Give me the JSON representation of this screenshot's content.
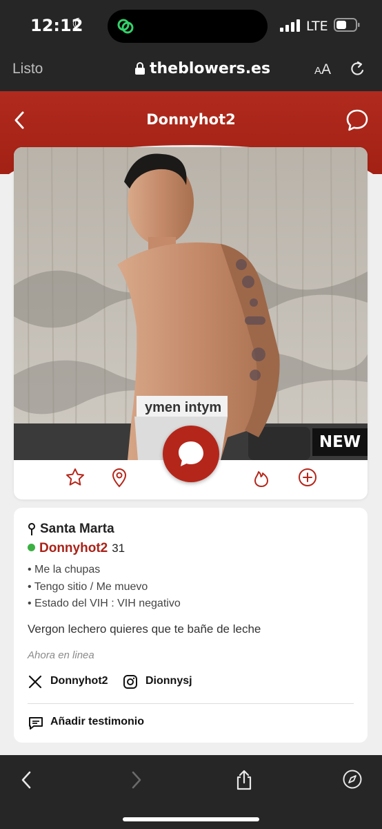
{
  "status": {
    "time": "12:12",
    "network": "LTE",
    "moon_icon": "moon-icon"
  },
  "browser": {
    "done_label": "Listo",
    "domain": "theblowers.es",
    "text_size_small": "A",
    "text_size_big": "A"
  },
  "header": {
    "title": "Donnyhot2"
  },
  "photo": {
    "badge": "NEW"
  },
  "actions": [
    "star-icon",
    "location-pin-icon",
    "chat-bubble-icon",
    "flame-icon",
    "plus-circle-icon"
  ],
  "profile": {
    "location": "Santa Marta",
    "username": "Donnyhot2",
    "age": "31",
    "bullets": [
      "• Me la chupas",
      "• Tengo sitio / Me muevo",
      "• Estado del VIH : VIH negativo"
    ],
    "description": "Vergon lechero quieres que te bañe de leche",
    "online_status": "Ahora en linea",
    "twitter": "Donnyhot2",
    "instagram": "Dionnysj",
    "add_testimonial": "Añadir testimonio"
  },
  "colors": {
    "brand_red": "#a92219",
    "online_green": "#3cb043",
    "dark_bar": "#262626"
  }
}
